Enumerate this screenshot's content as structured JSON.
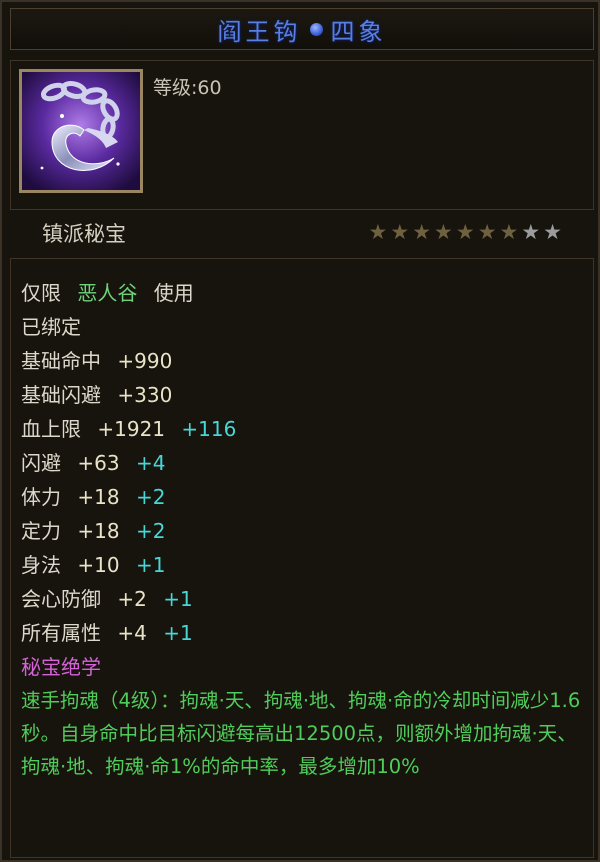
{
  "title": {
    "left": "阎王钩",
    "right": "四象"
  },
  "item": {
    "icon": "hook-chain-icon",
    "level": "等级:60"
  },
  "category": "镇派秘宝",
  "stars": {
    "total": 9,
    "filled": 7
  },
  "restriction": {
    "prefix": "仅限",
    "faction": "恶人谷",
    "suffix": "使用"
  },
  "bound": "已绑定",
  "stats": [
    {
      "name": "基础命中",
      "base": "+990",
      "bonus": ""
    },
    {
      "name": "基础闪避",
      "base": "+330",
      "bonus": ""
    },
    {
      "name": "血上限",
      "base": "+1921",
      "bonus": "+116"
    },
    {
      "name": "闪避",
      "base": "+63",
      "bonus": "+4"
    },
    {
      "name": "体力",
      "base": "+18",
      "bonus": "+2"
    },
    {
      "name": "定力",
      "base": "+18",
      "bonus": "+2"
    },
    {
      "name": "身法",
      "base": "+10",
      "bonus": "+1"
    },
    {
      "name": "会心防御",
      "base": "+2",
      "bonus": "+1"
    },
    {
      "name": "所有属性",
      "base": "+4",
      "bonus": "+1"
    }
  ],
  "skill_header": "秘宝绝学",
  "skill_desc": "速手拘魂（4级）：拘魂·天、拘魂·地、拘魂·命的冷却时间减少1.6秒。自身命中比目标闪避每高出12500点，则额外增加拘魂·天、拘魂·地、拘魂·命1%的命中率，最多增加10%",
  "colors": {
    "title": "#5a7fe0",
    "faction": "#6fd27a",
    "bonus": "#47d7d7",
    "skill_header": "#d463d8",
    "skill_text": "#4fcc5a"
  }
}
